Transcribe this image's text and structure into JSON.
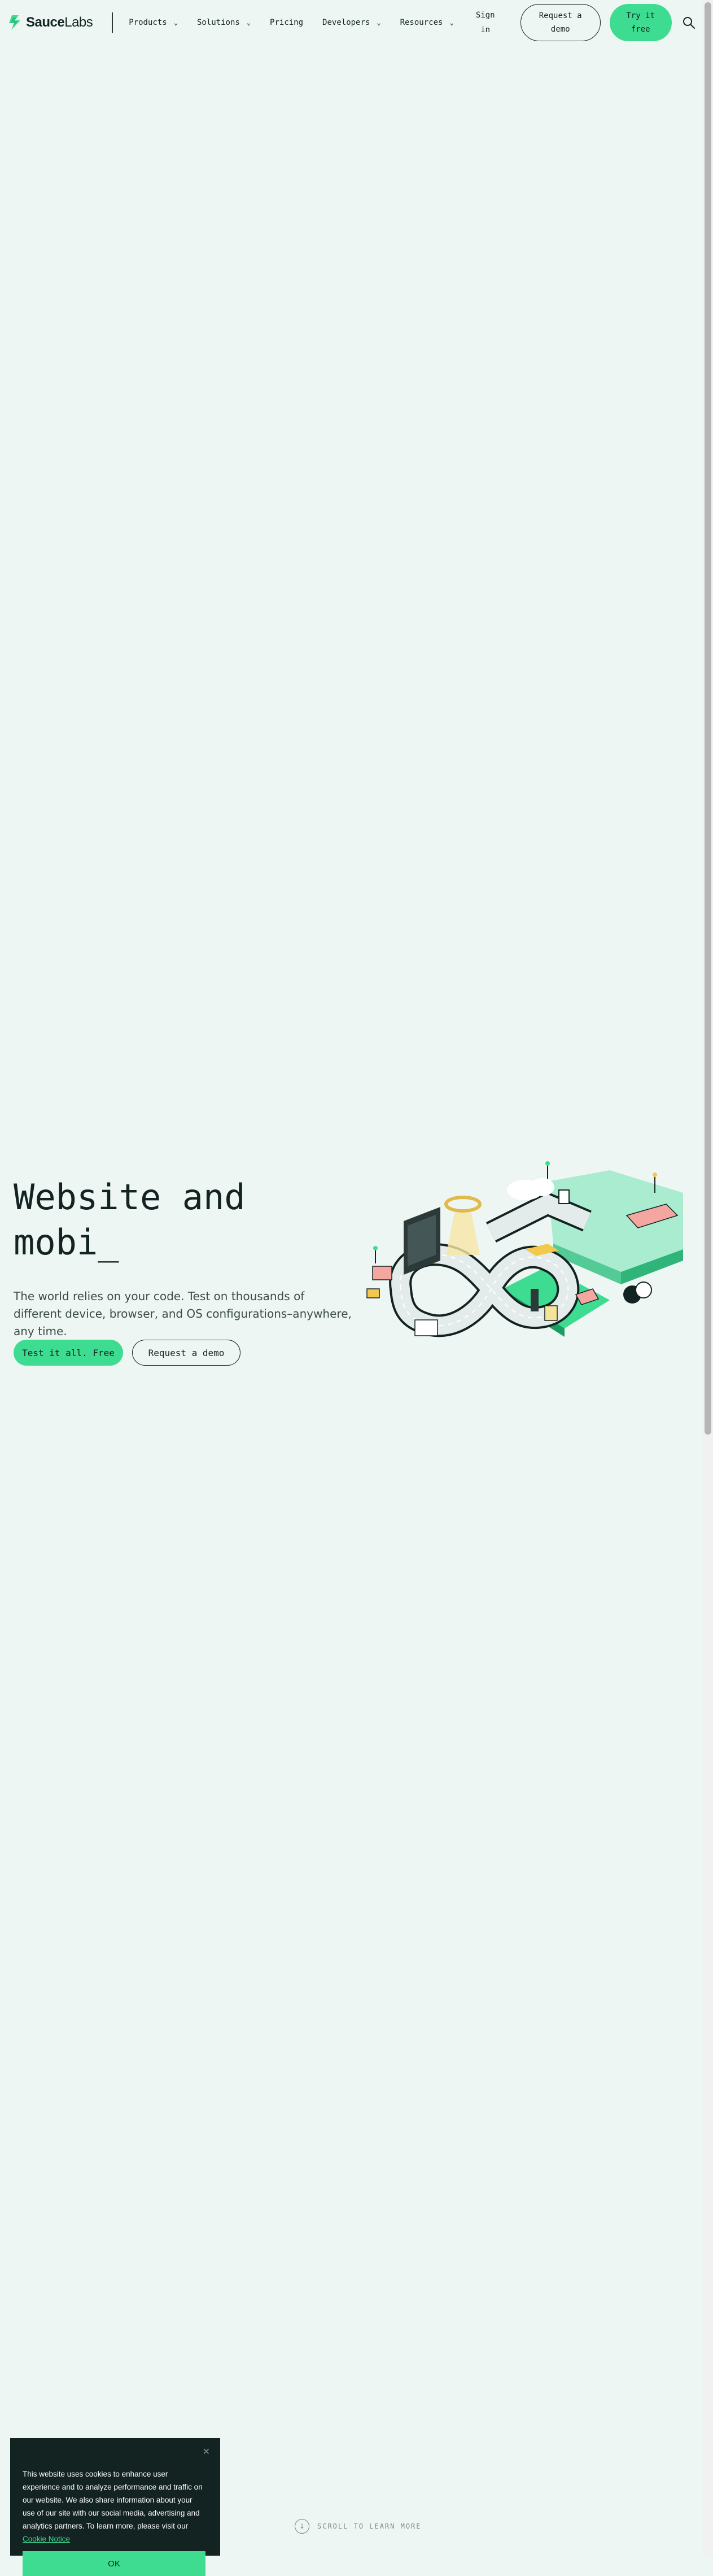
{
  "brand": {
    "name_bold": "Sauce",
    "name_regular": "Labs"
  },
  "nav": {
    "items": [
      {
        "label": "Products",
        "has_dropdown": true
      },
      {
        "label": "Solutions",
        "has_dropdown": true
      },
      {
        "label": "Pricing",
        "has_dropdown": false
      },
      {
        "label": "Developers",
        "has_dropdown": true
      },
      {
        "label": "Resources",
        "has_dropdown": true
      }
    ],
    "signin_line1": "Sign",
    "signin_line2": "in",
    "request_demo_line1": "Request a",
    "request_demo_line2": "demo",
    "try_free_line1": "Try it",
    "try_free_line2": "free",
    "search_icon": "search-icon"
  },
  "hero": {
    "title_line1": "Website and",
    "title_line2": "mobi_",
    "subtitle": "The world relies on your code. Test on thousands of different device, browser, and OS configurations–anywhere, any time.",
    "primary_button": "Test it all. Free",
    "secondary_button": "Request a demo"
  },
  "scroll_hint": {
    "label": "SCROLL TO LEARN MORE",
    "icon": "arrow-down-icon"
  },
  "cookie": {
    "text": "This website uses cookies to enhance user experience and to analyze performance and traffic on our website. We also share information about your use of our site with our social media, advertising and analytics partners. To learn more, please visit our",
    "link": "Cookie Notice",
    "ok_button": "OK",
    "close_icon": "close-icon"
  },
  "colors": {
    "background": "#eef6f4",
    "accent_green": "#3ddc91",
    "text_dark": "#132322",
    "cookie_bg": "#132322"
  }
}
